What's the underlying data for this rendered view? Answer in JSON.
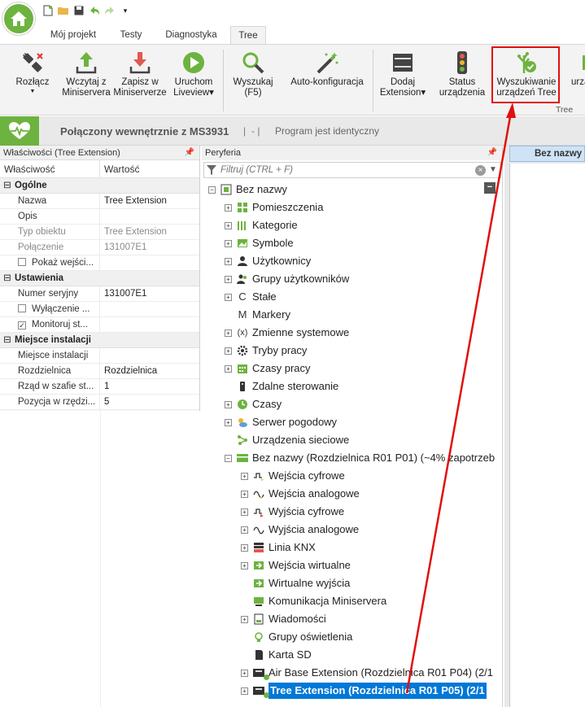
{
  "titlebar": {
    "qat": [
      {
        "name": "new-file-icon",
        "glyph": "🗋"
      },
      {
        "name": "open-folder-icon",
        "glyph": "📂"
      },
      {
        "name": "save-icon",
        "glyph": "💾"
      },
      {
        "name": "undo-icon",
        "glyph": "↶"
      },
      {
        "name": "redo-icon",
        "glyph": "↷"
      },
      {
        "name": "customize-icon",
        "glyph": "▾"
      }
    ]
  },
  "tabs": [
    {
      "label": "Mój projekt"
    },
    {
      "label": "Testy"
    },
    {
      "label": "Diagnostyka"
    },
    {
      "label": "Tree"
    }
  ],
  "ribbon": {
    "buttons": [
      {
        "label": "Rozłącz",
        "line2": "",
        "caret": "▼"
      },
      {
        "label": "Wczytaj z",
        "line2": "Miniservera"
      },
      {
        "label": "Zapisz w",
        "line2": "Miniserverze"
      },
      {
        "label": "Uruchom",
        "line2": "Liveview▾"
      },
      {
        "label": "Wyszukaj",
        "line2": "(F5)"
      },
      {
        "label": "Auto-konfiguracja",
        "line2": ""
      },
      {
        "label": "Dodaj",
        "line2": "Extension▾"
      },
      {
        "label": "Status",
        "line2": "urządzenia"
      },
      {
        "label": "Wyszukiwanie",
        "line2": "urządzeń Tree"
      }
    ],
    "group_label": "Tree",
    "partial_label": "urządze"
  },
  "status": {
    "title": "Połączony wewnętrznie z MS3931",
    "sep": "|",
    "dash": "-  |",
    "program": "Program jest identyczny"
  },
  "properties": {
    "header": "Właściwości (Tree Extension)",
    "col_name": "Właściwość",
    "col_value": "Wartość",
    "sections": [
      {
        "title": "Ogólne",
        "rows": [
          {
            "name": "Nazwa",
            "value": "Tree Extension"
          },
          {
            "name": "Opis",
            "value": ""
          },
          {
            "name": "Typ obiektu",
            "value": "Tree Extension",
            "dim": true
          },
          {
            "name": "Połączenie",
            "value": "131007E1",
            "dim": true
          },
          {
            "name": "Pokaż wejści...",
            "value": "",
            "checkbox": true,
            "checked": false
          }
        ]
      },
      {
        "title": "Ustawienia",
        "rows": [
          {
            "name": "Numer seryjny",
            "value": "131007E1"
          },
          {
            "name": "Wyłączenie ...",
            "value": "",
            "checkbox": true,
            "checked": false
          },
          {
            "name": "Monitoruj st...",
            "value": "",
            "checkbox": true,
            "checked": true
          }
        ]
      },
      {
        "title": "Miejsce instalacji",
        "rows": [
          {
            "name": "Miejsce instalacji",
            "value": ""
          },
          {
            "name": "Rozdzielnica",
            "value": "Rozdzielnica"
          },
          {
            "name": "Rząd w szafie st...",
            "value": "1"
          },
          {
            "name": "Pozycja w rzędzi...",
            "value": "5"
          }
        ]
      }
    ]
  },
  "peripherals": {
    "header": "Peryferia",
    "filter_placeholder": "Filtruj (CTRL + F)",
    "tree": [
      {
        "label": "Bez nazwy",
        "level": 0,
        "exp": "minus",
        "icon": "miniserver-icon"
      },
      {
        "label": "Pomieszczenia",
        "level": 1,
        "exp": "plus",
        "icon": "rooms-icon"
      },
      {
        "label": "Kategorie",
        "level": 1,
        "exp": "plus",
        "icon": "categories-icon"
      },
      {
        "label": "Symbole",
        "level": 1,
        "exp": "plus",
        "icon": "symbols-icon"
      },
      {
        "label": "Użytkownicy",
        "level": 1,
        "exp": "plus",
        "icon": "user-icon"
      },
      {
        "label": "Grupy użytkowników",
        "level": 1,
        "exp": "plus",
        "icon": "user-group-icon"
      },
      {
        "label": "Stałe",
        "level": 1,
        "exp": "plus",
        "icon": "constant-icon"
      },
      {
        "label": "Markery",
        "level": 1,
        "exp": "none",
        "icon": "marker-icon"
      },
      {
        "label": "Zmienne systemowe",
        "level": 1,
        "exp": "plus",
        "icon": "system-variable-icon"
      },
      {
        "label": "Tryby pracy",
        "level": 1,
        "exp": "plus",
        "icon": "operating-mode-icon"
      },
      {
        "label": "Czasy pracy",
        "level": 1,
        "exp": "plus",
        "icon": "calendar-icon"
      },
      {
        "label": "Zdalne sterowanie",
        "level": 1,
        "exp": "none",
        "icon": "remote-control-icon"
      },
      {
        "label": "Czasy",
        "level": 1,
        "exp": "plus",
        "icon": "clock-icon"
      },
      {
        "label": "Serwer pogodowy",
        "level": 1,
        "exp": "plus",
        "icon": "weather-icon"
      },
      {
        "label": "Urządzenia sieciowe",
        "level": 1,
        "exp": "none",
        "icon": "network-icon"
      },
      {
        "label": "Bez nazwy (Rozdzielnica R01 P01) (~4% zapotrzeb",
        "level": 1,
        "exp": "minus",
        "icon": "miniserver-device-icon"
      },
      {
        "label": "Wejścia cyfrowe",
        "level": 2,
        "exp": "plus",
        "icon": "digital-input-icon"
      },
      {
        "label": "Wejścia analogowe",
        "level": 2,
        "exp": "plus",
        "icon": "analog-input-icon"
      },
      {
        "label": "Wyjścia cyfrowe",
        "level": 2,
        "exp": "plus",
        "icon": "digital-output-icon"
      },
      {
        "label": "Wyjścia analogowe",
        "level": 2,
        "exp": "plus",
        "icon": "analog-output-icon"
      },
      {
        "label": "Linia KNX",
        "level": 2,
        "exp": "plus",
        "icon": "knx-icon"
      },
      {
        "label": "Wejścia wirtualne",
        "level": 2,
        "exp": "plus",
        "icon": "virtual-input-icon"
      },
      {
        "label": "Wirtualne wyjścia",
        "level": 2,
        "exp": "none",
        "icon": "virtual-output-icon"
      },
      {
        "label": "Komunikacja Miniservera",
        "level": 2,
        "exp": "none",
        "icon": "communication-icon"
      },
      {
        "label": "Wiadomości",
        "level": 2,
        "exp": "plus",
        "icon": "messages-icon"
      },
      {
        "label": "Grupy oświetlenia",
        "level": 2,
        "exp": "none",
        "icon": "lighting-group-icon"
      },
      {
        "label": "Karta SD",
        "level": 2,
        "exp": "none",
        "icon": "sd-card-icon"
      },
      {
        "label": "Air Base Extension (Rozdzielnica R01 P04) (2/1",
        "level": 2,
        "exp": "plus",
        "icon": "air-extension-icon"
      },
      {
        "label": "Tree Extension (Rozdzielnica R01 P05) (2/1",
        "level": 2,
        "exp": "plus",
        "icon": "tree-extension-icon",
        "selected": true
      }
    ]
  },
  "document": {
    "tab_label": "Bez nazwy"
  },
  "colors": {
    "brand_green": "#6db33f",
    "selection_blue": "#0078d7",
    "highlight_red": "#e01010"
  }
}
